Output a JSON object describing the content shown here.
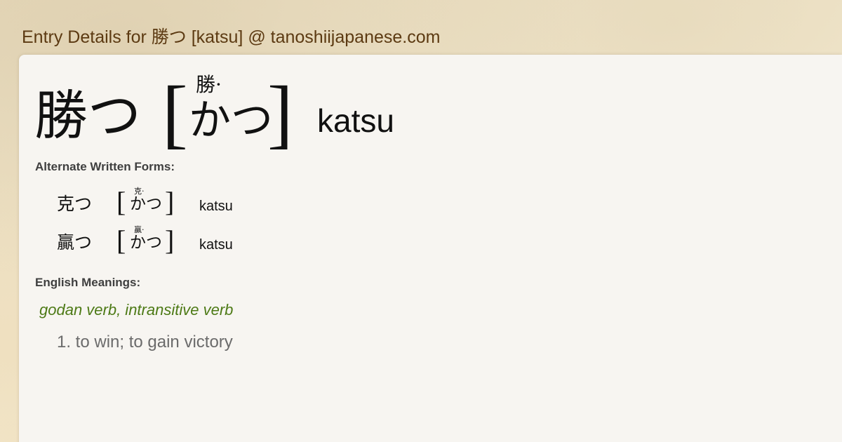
{
  "site_title": "Entry Details for 勝つ [katsu] @ tanoshiijapanese.com",
  "entry": {
    "word": "勝つ",
    "furigana": "勝·",
    "reading": "かつ",
    "romaji": "katsu",
    "bracket_open": "[",
    "bracket_close": "]"
  },
  "alternate_forms": {
    "heading": "Alternate Written Forms:",
    "items": [
      {
        "word": "克つ",
        "furigana": "克·",
        "reading": "かつ",
        "romaji": "katsu"
      },
      {
        "word": "贏つ",
        "furigana": "贏·",
        "reading": "かつ",
        "romaji": "katsu"
      }
    ]
  },
  "meanings": {
    "heading": "English Meanings:",
    "part_of_speech": "godan verb, intransitive verb",
    "items": [
      "1. to win; to gain victory"
    ]
  },
  "colors": {
    "title": "#5c3a12",
    "part_of_speech": "#4d7a16",
    "meaning": "#6b6b6b",
    "panel": "#f7f5f1"
  }
}
